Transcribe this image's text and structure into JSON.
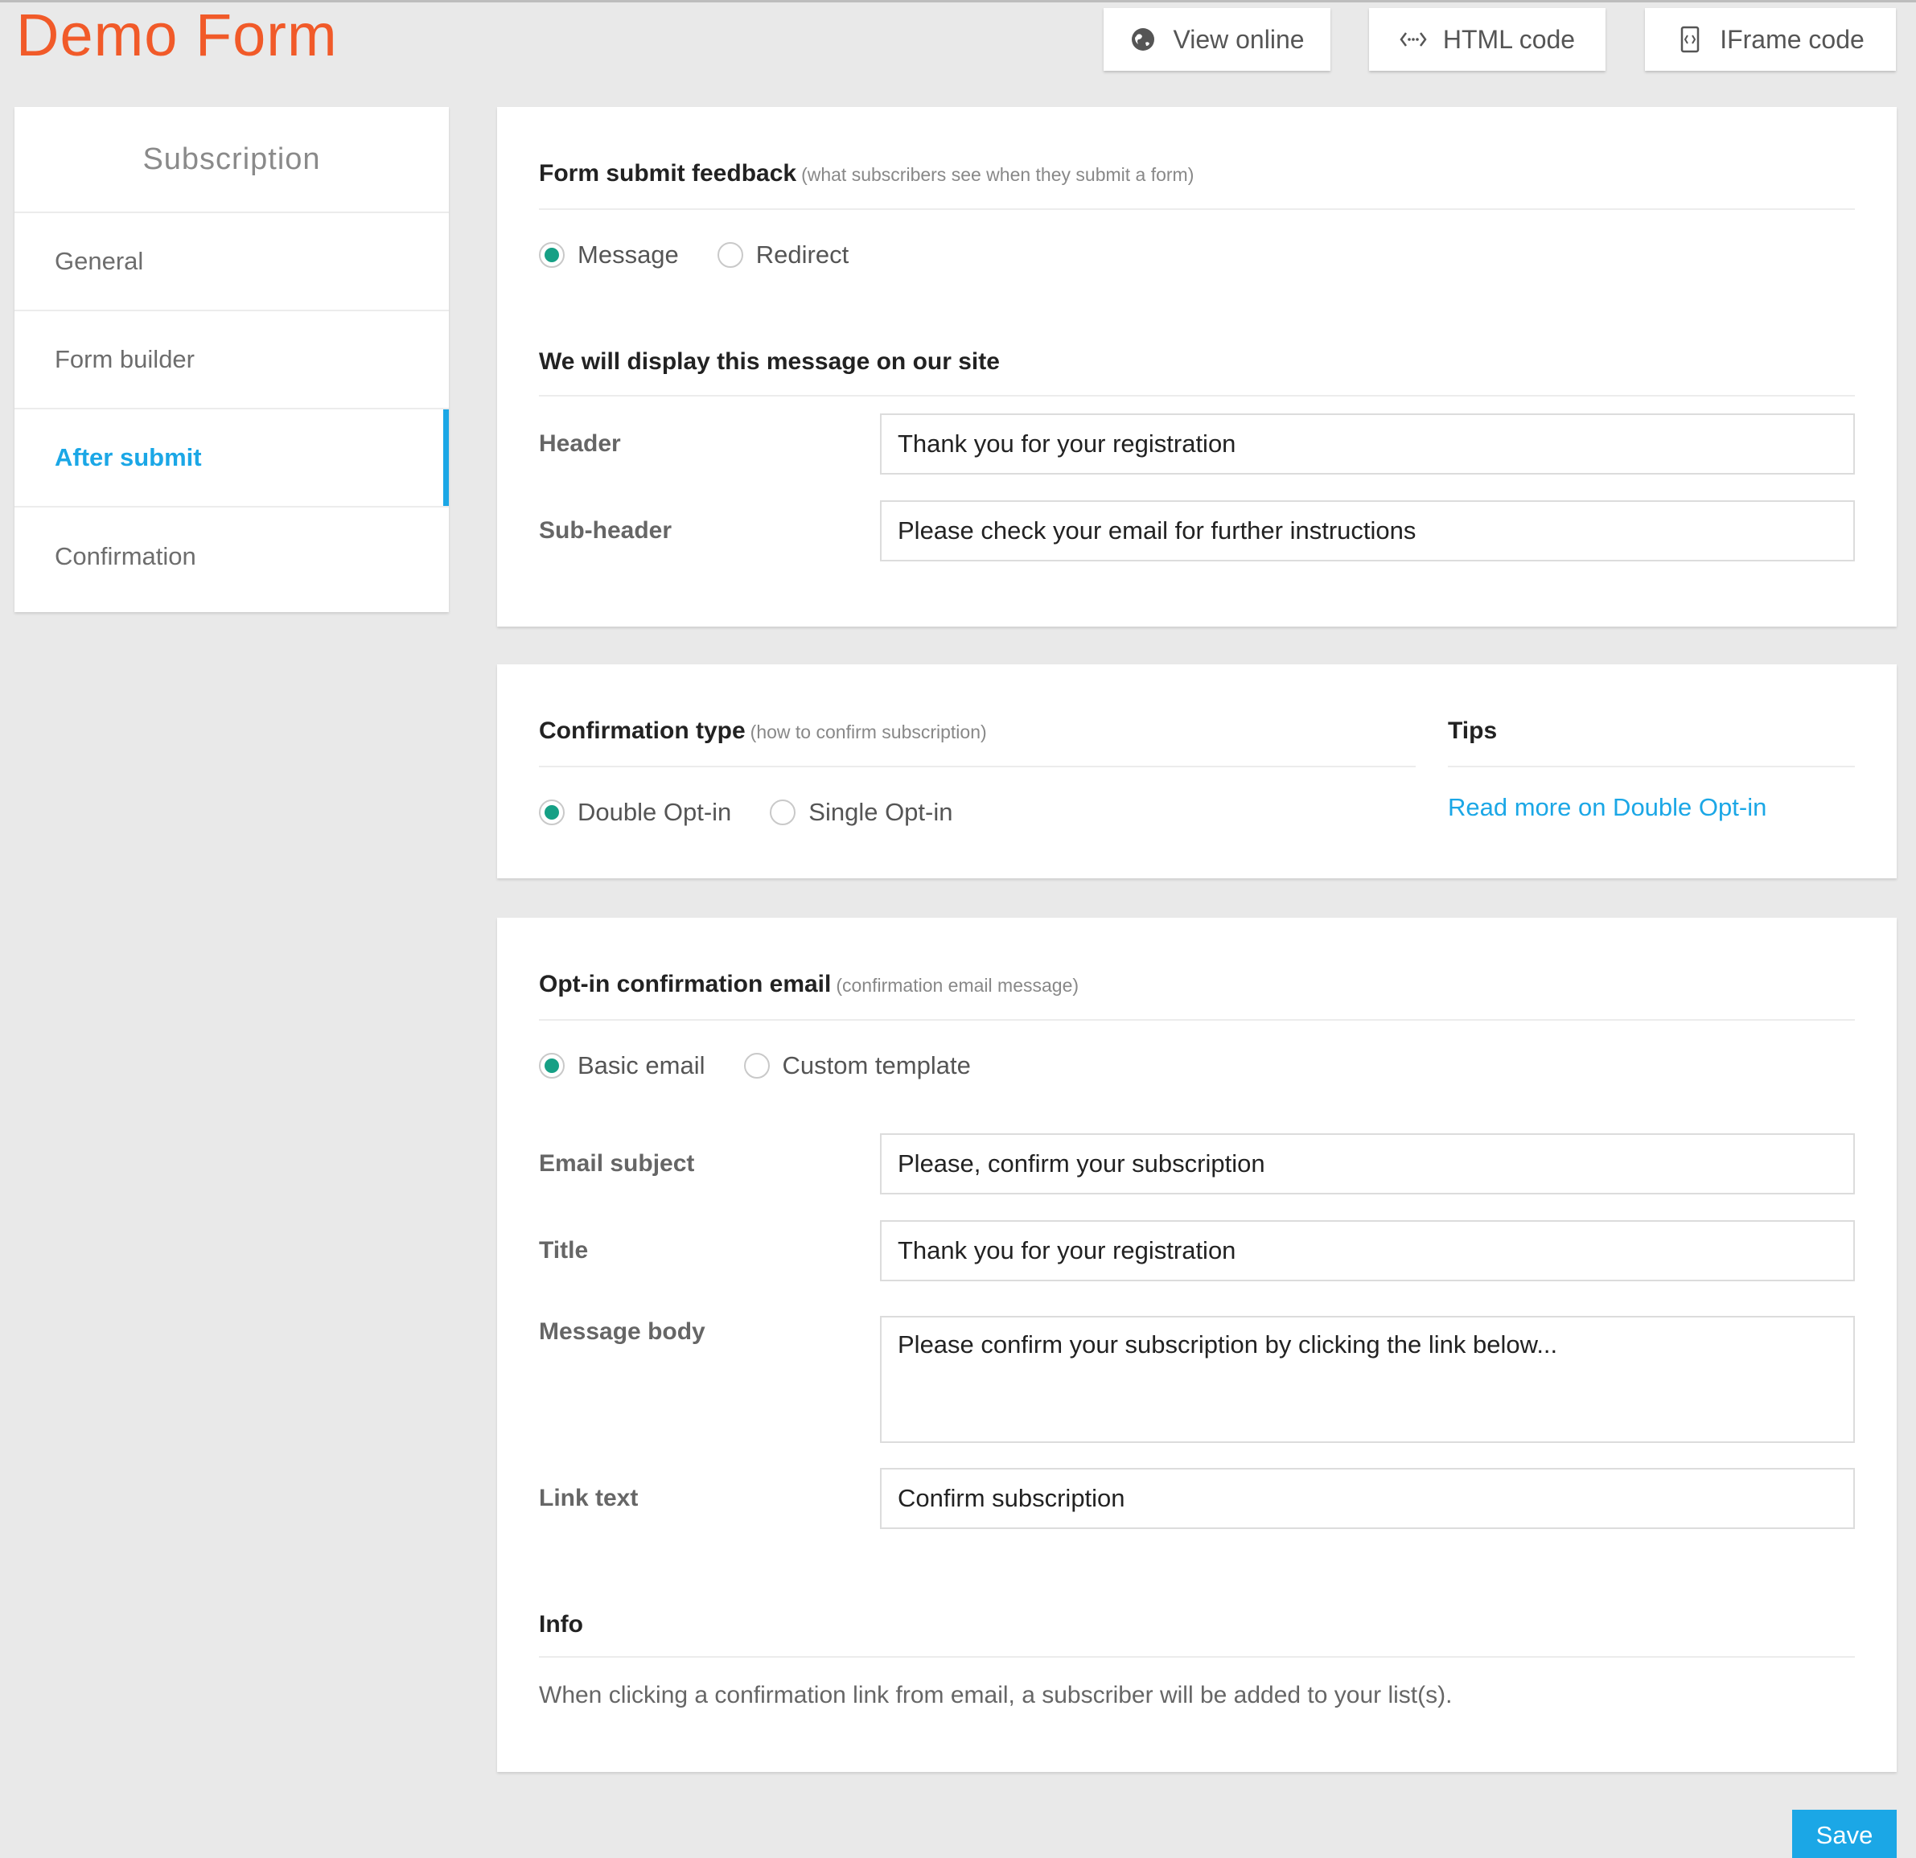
{
  "header": {
    "title": "Demo Form",
    "title_color": "#f15a29",
    "buttons": {
      "view_online": "View online",
      "view_online_icon": "globe-icon",
      "html_code": "HTML code",
      "html_code_icon": "code-icon",
      "iframe_code": "IFrame code",
      "iframe_code_icon": "iframe-icon"
    }
  },
  "sidebar": {
    "heading": "Subscription",
    "items": [
      {
        "label": "General",
        "active": false
      },
      {
        "label": "Form builder",
        "active": false
      },
      {
        "label": "After submit",
        "active": true
      },
      {
        "label": "Confirmation",
        "active": false
      }
    ],
    "active_color": "#1ba7e6"
  },
  "feedback": {
    "title": "Form submit feedback",
    "hint": "(what subscribers see when they submit a form)",
    "options": [
      {
        "label": "Message",
        "selected": true
      },
      {
        "label": "Redirect",
        "selected": false
      }
    ],
    "message_section_title": "We will display this message on our site",
    "header_label": "Header",
    "header_value": "Thank you for your registration",
    "subheader_label": "Sub-header",
    "subheader_value": "Please check your email for further instructions"
  },
  "confirmation_type": {
    "title": "Confirmation type",
    "hint": "(how to confirm subscription)",
    "options": [
      {
        "label": "Double Opt-in",
        "selected": true
      },
      {
        "label": "Single Opt-in",
        "selected": false
      }
    ],
    "tips_title": "Tips",
    "tips_link": "Read more on Double Opt-in"
  },
  "optin_email": {
    "title": "Opt-in confirmation email",
    "hint": "(confirmation email message)",
    "options": [
      {
        "label": "Basic email",
        "selected": true
      },
      {
        "label": "Custom template",
        "selected": false
      }
    ],
    "subject_label": "Email subject",
    "subject_value": "Please, confirm your subscription",
    "title_label": "Title",
    "title_value": "Thank you for your registration",
    "body_label": "Message body",
    "body_value": "Please confirm your subscription by clicking the link below...",
    "link_label": "Link text",
    "link_value": "Confirm subscription",
    "info_title": "Info",
    "info_text": "When clicking a confirmation link from email, a subscriber will be added to your list(s)."
  },
  "footer": {
    "save_label": "Save",
    "save_color": "#1ba7e6"
  },
  "colors": {
    "selected_radio": "#16a085",
    "background": "#e9e9e9"
  }
}
